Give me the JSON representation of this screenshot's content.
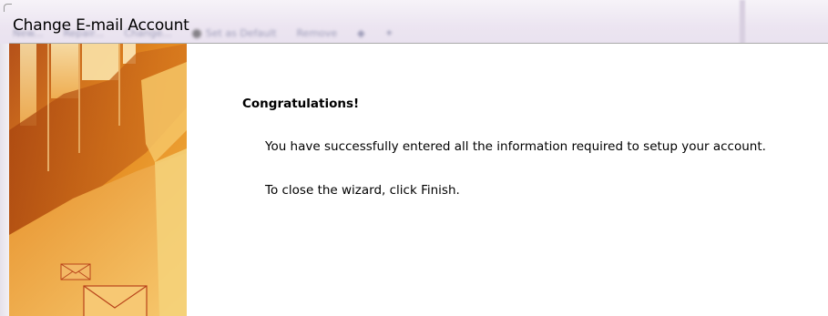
{
  "window": {
    "title": "Change E-mail Account"
  },
  "background_toolbar": {
    "items": [
      "New...",
      "Repair...",
      "Change...",
      "Set as Default",
      "Remove"
    ]
  },
  "main": {
    "heading": "Congratulations!",
    "message": "You have successfully entered all the information required to setup your account.",
    "instruction": "To close the wizard, click Finish."
  },
  "colors": {
    "art_dark": "#c25a10",
    "art_mid": "#e8921e",
    "art_light": "#f6c566",
    "art_pale": "#fbe6b0",
    "envelope_stroke": "#b8431a"
  }
}
